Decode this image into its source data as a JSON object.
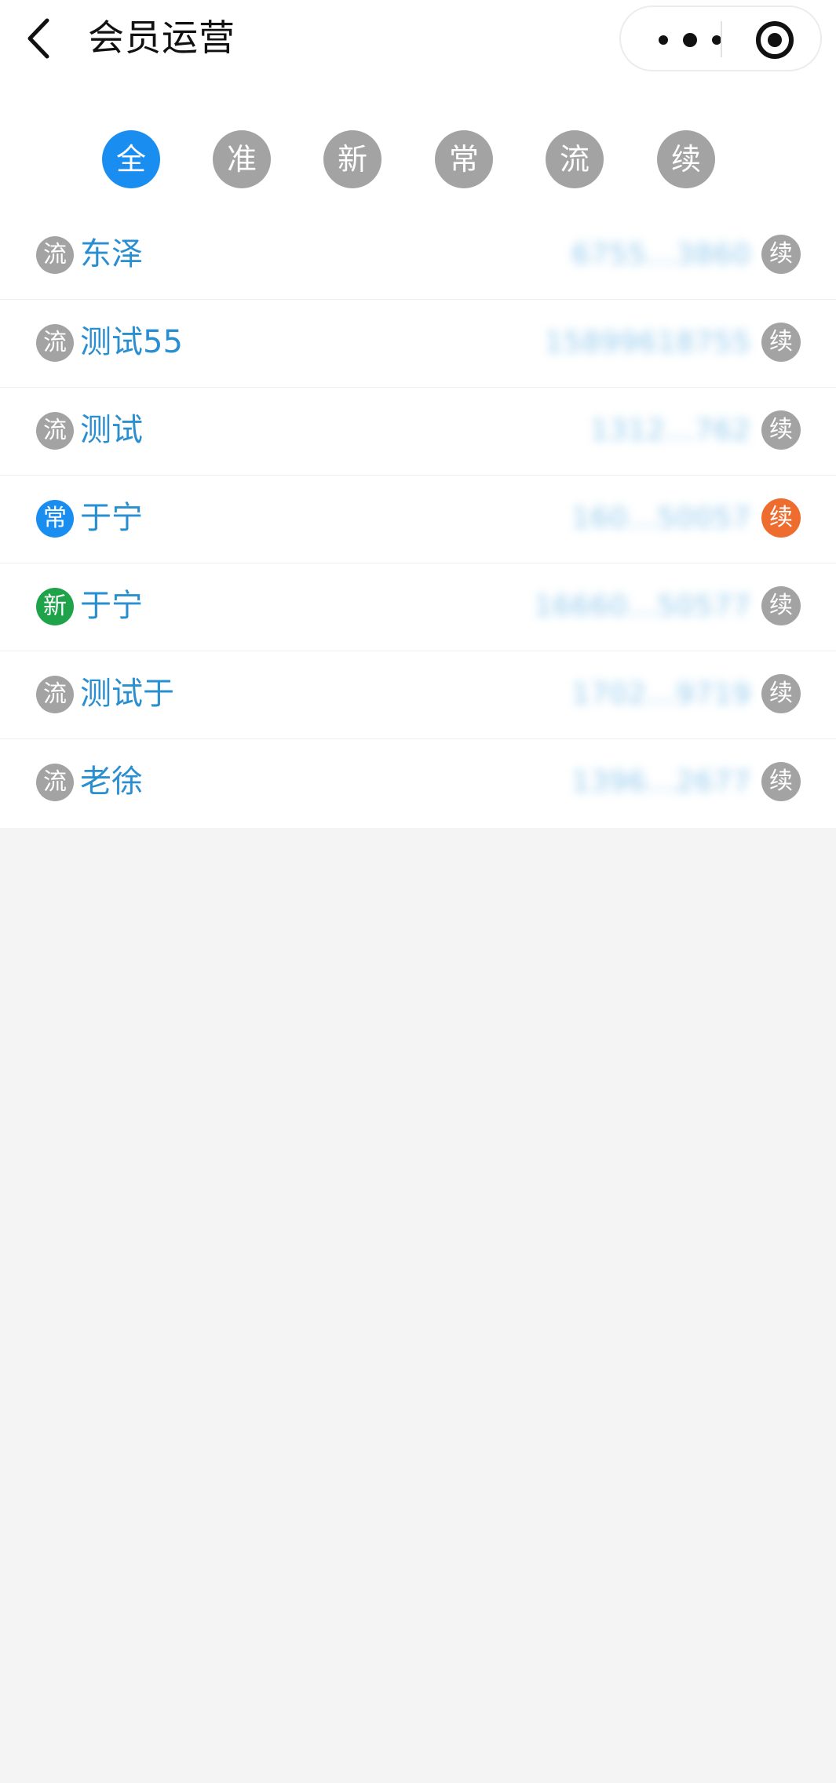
{
  "header": {
    "title": "会员运营"
  },
  "tabs": [
    {
      "label": "全",
      "active": true
    },
    {
      "label": "准",
      "active": false
    },
    {
      "label": "新",
      "active": false
    },
    {
      "label": "常",
      "active": false
    },
    {
      "label": "流",
      "active": false
    },
    {
      "label": "续",
      "active": false
    }
  ],
  "colors": {
    "accent": "#1a8ef0",
    "inactive_tab": "#a3a3a3",
    "name_text": "#2a8fd0",
    "status_flow": "#a3a3a3",
    "status_regular": "#1a8ef0",
    "status_new": "#1ea34a",
    "renew_default": "#a3a3a3",
    "renew_highlight": "#ef6c2f"
  },
  "members": [
    {
      "status": "流",
      "name": "东泽",
      "phone": "6755...3860",
      "renew": "续"
    },
    {
      "status": "流",
      "name": "测试55",
      "phone": "15899618755",
      "renew": "续"
    },
    {
      "status": "流",
      "name": "测试",
      "phone": "1312...762",
      "renew": "续"
    },
    {
      "status": "常",
      "name": "于宁",
      "phone": "160...50057",
      "renew": "续"
    },
    {
      "status": "新",
      "name": "于宁",
      "phone": "16660...50577",
      "renew": "续"
    },
    {
      "status": "流",
      "name": "测试于",
      "phone": "1702...9719",
      "renew": "续"
    },
    {
      "status": "流",
      "name": "老徐",
      "phone": "1396...2677",
      "renew": "续"
    }
  ]
}
